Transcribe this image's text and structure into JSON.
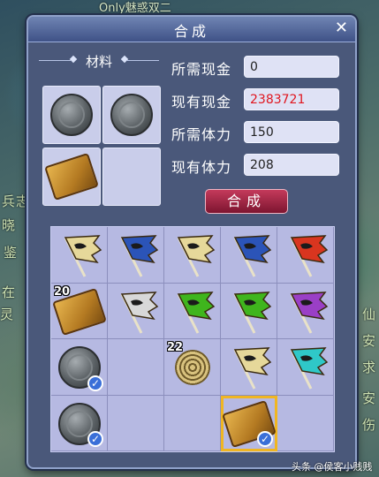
{
  "background": {
    "top_text": "Only魅惑双二",
    "side_chars": [
      "兵",
      "志",
      "晓",
      "鉴",
      "在",
      "灵",
      "仙",
      "安",
      "求",
      "安",
      "伤"
    ]
  },
  "dialog": {
    "title": "合成",
    "close": "✕",
    "materials_title": "材料",
    "required_cash_label": "所需现金",
    "required_cash_value": "0",
    "current_cash_label": "现有现金",
    "current_cash_value": "2383721",
    "required_stamina_label": "所需体力",
    "required_stamina_value": "150",
    "current_stamina_label": "现有体力",
    "current_stamina_value": "208",
    "synthesize_button": "合成"
  },
  "materials": [
    {
      "item": "coin"
    },
    {
      "item": "coin"
    },
    {
      "item": "scroll"
    },
    {
      "item": "empty"
    }
  ],
  "inventory": [
    {
      "item": "flag",
      "color": "#e6d89a",
      "qty": "",
      "checked": false
    },
    {
      "item": "flag",
      "color": "#2b54b8",
      "qty": "",
      "checked": false
    },
    {
      "item": "flag",
      "color": "#e6d89a",
      "qty": "",
      "checked": false
    },
    {
      "item": "flag",
      "color": "#2b54b8",
      "qty": "",
      "checked": false
    },
    {
      "item": "flag",
      "color": "#d9351f",
      "qty": "",
      "checked": false
    },
    {
      "item": "scroll-map",
      "color": "#b8873a",
      "qty": "20",
      "checked": false
    },
    {
      "item": "flag",
      "color": "#d8d8d8",
      "qty": "",
      "checked": false
    },
    {
      "item": "flag",
      "color": "#3fb51d",
      "qty": "",
      "checked": false
    },
    {
      "item": "flag",
      "color": "#3fb51d",
      "qty": "",
      "checked": false
    },
    {
      "item": "flag",
      "color": "#9a3fc6",
      "qty": "",
      "checked": false
    },
    {
      "item": "coin",
      "qty": "",
      "checked": true
    },
    {
      "item": "empty",
      "qty": "",
      "checked": false
    },
    {
      "item": "spring",
      "qty": "22",
      "checked": false
    },
    {
      "item": "flag",
      "color": "#e6d89a",
      "qty": "",
      "checked": false
    },
    {
      "item": "flag",
      "color": "#2fc8c8",
      "qty": "",
      "checked": false
    },
    {
      "item": "coin",
      "qty": "",
      "checked": true
    },
    {
      "item": "empty",
      "qty": "",
      "checked": false
    },
    {
      "item": "empty",
      "qty": "",
      "checked": false
    },
    {
      "item": "scroll",
      "qty": "",
      "checked": true,
      "selected": true
    },
    {
      "item": "empty",
      "qty": "",
      "checked": false
    }
  ],
  "watermark": "头条 @侯客小贱贱"
}
